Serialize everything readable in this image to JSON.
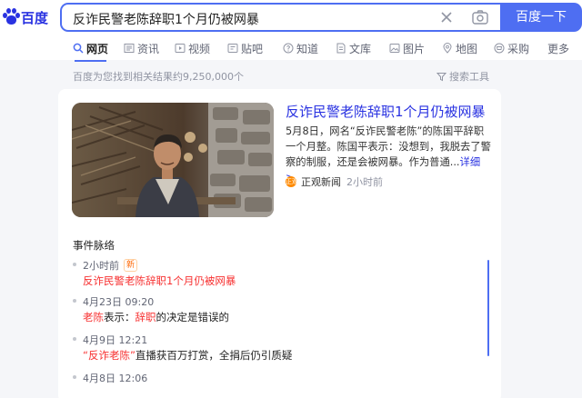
{
  "brand": {
    "logo_text": "百度",
    "color": "#2932e1"
  },
  "search": {
    "query": "反诈民警老陈辞职1个月仍被网暴",
    "button_label": "百度一下",
    "accent": "#4e6ef2"
  },
  "tabs": [
    {
      "label": "网页",
      "icon": "search-icon",
      "active": true
    },
    {
      "label": "资讯",
      "icon": "news-icon"
    },
    {
      "label": "视频",
      "icon": "video-icon"
    },
    {
      "label": "贴吧",
      "icon": "tieba-icon"
    },
    {
      "label": "知道",
      "icon": "question-icon"
    },
    {
      "label": "文库",
      "icon": "document-icon"
    },
    {
      "label": "图片",
      "icon": "image-icon"
    },
    {
      "label": "地图",
      "icon": "map-pin-icon"
    },
    {
      "label": "采购",
      "icon": "cart-icon"
    },
    {
      "label": "更多"
    }
  ],
  "results_meta": {
    "count_text": "百度为您找到相关结果约9,250,000个",
    "tools_label": "搜索工具"
  },
  "news_card": {
    "title": "反诈民警老陈辞职1个月仍被网暴",
    "abstract": "5月8日，网名“反诈民警老陈”的陈国平辞职一个月整。陈国平表示：没想到，我脱去了警察的制服，还是会被网暴。作为普通...",
    "more_label": "详细 >",
    "source": "正观新闻",
    "source_badge": "正观",
    "time": "2小时前"
  },
  "timeline": {
    "heading": "事件脉络",
    "events": [
      {
        "time": "2小时前",
        "badge": "新",
        "headline_pre": "",
        "headline_red": "反诈民警老陈辞职1个月仍被网暴",
        "headline_mid": "",
        "headline_red2": "",
        "headline_post": ""
      },
      {
        "time": "4月23日 09:20",
        "badge": "",
        "headline_pre": "",
        "headline_red": "老陈",
        "headline_mid": "表示：",
        "headline_red2": "辞职",
        "headline_post": "的决定是错误的"
      },
      {
        "time": "4月9日 12:21",
        "badge": "",
        "headline_pre": "",
        "headline_red": "“反诈老陈”",
        "headline_mid": "直播获百万打赏，全捐后仍引质疑",
        "headline_red2": "",
        "headline_post": ""
      },
      {
        "time": "4月8日 12:06",
        "badge": "",
        "headline_pre": "",
        "headline_red": "",
        "headline_mid": "",
        "headline_red2": "",
        "headline_post": ""
      }
    ]
  }
}
